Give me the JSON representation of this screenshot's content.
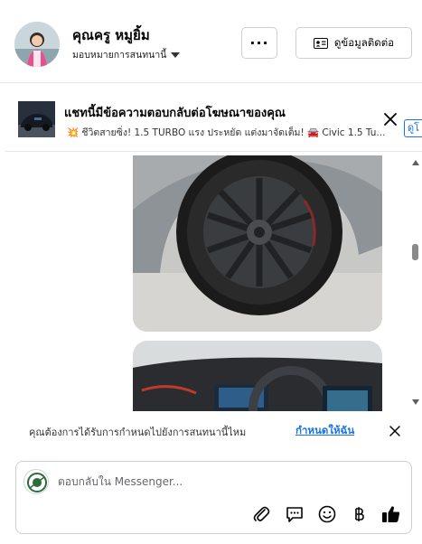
{
  "header": {
    "contact_name": "คุณครู หมูยิ้ม",
    "assign_label": "มอบหมายการสนทนานี้",
    "more_label": "···",
    "contact_info_label": "ดูข้อมูลติดต่อ"
  },
  "ad_banner": {
    "title": "แชทนี้มีข้อความตอบกลับต่อโฆษณาของคุณ",
    "snippet": "💥 ชีวิตสายซิ่ง! 1.5 TURBO แรง ประหยัด แต่งมาจัดเต็ม! 🚘 Civic 1.5 Tu...",
    "link_label": "ดูโ"
  },
  "chat": {
    "images": [
      {
        "name": "car-wheel-photo",
        "icon": "alloy-wheel-image"
      },
      {
        "name": "car-interior-photo",
        "icon": "dashboard-image"
      }
    ]
  },
  "reminder": {
    "text": "คุณต้องการได้รับการกำหนดไปยังการสนทนานี้ไหม",
    "link_label": "กำหนดให้ฉัน"
  },
  "composer": {
    "placeholder": "ตอบกลับใน Messenger...",
    "tools": [
      "attachment-icon",
      "saved-replies-icon",
      "emoji-icon",
      "baht-payment-icon",
      "like-icon"
    ]
  },
  "colors": {
    "accent": "#1b74e4",
    "border": "#ccd0d5",
    "text": "#050505"
  }
}
